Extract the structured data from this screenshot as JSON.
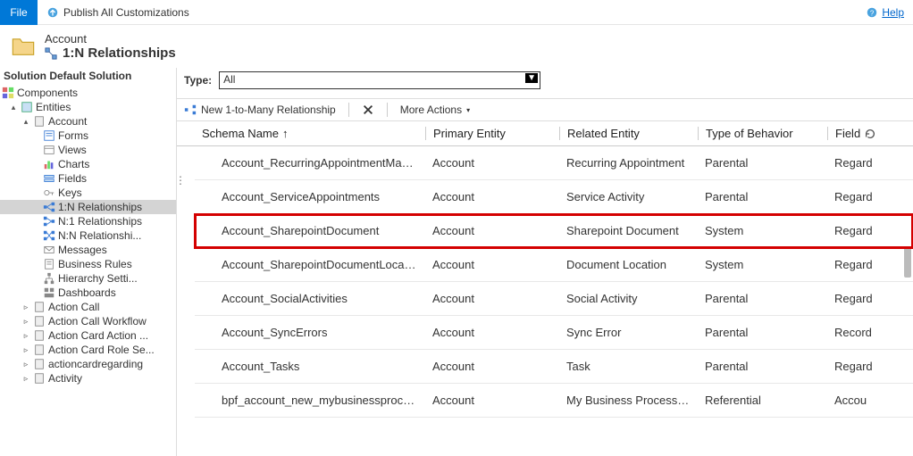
{
  "topbar": {
    "file": "File",
    "publish": "Publish All Customizations",
    "help": "Help"
  },
  "header": {
    "entity": "Account",
    "page": "1:N Relationships"
  },
  "solution_label": "Solution Default Solution",
  "tree": {
    "components": "Components",
    "entities": "Entities",
    "account": "Account",
    "forms": "Forms",
    "views": "Views",
    "charts": "Charts",
    "fields": "Fields",
    "keys": "Keys",
    "rel1n": "1:N Relationships",
    "reln1": "N:1 Relationships",
    "relnn": "N:N Relationshi...",
    "messages": "Messages",
    "busrules": "Business Rules",
    "hierarchy": "Hierarchy Setti...",
    "dashboards": "Dashboards",
    "actioncall": "Action Call",
    "actioncallwf": "Action Call Workflow",
    "actioncardaction": "Action Card Action ...",
    "actioncardrole": "Action Card Role Se...",
    "actioncardreg": "actioncardregarding",
    "activity": "Activity"
  },
  "type_filter": {
    "label": "Type:",
    "value": "All"
  },
  "toolbar": {
    "new": "New 1-to-Many Relationship",
    "more": "More Actions"
  },
  "columns": {
    "schema": "Schema Name",
    "primary": "Primary Entity",
    "related": "Related Entity",
    "behavior": "Type of Behavior",
    "field": "Field"
  },
  "rows": [
    {
      "schema": "Account_RecurringAppointmentMasters",
      "primary": "Account",
      "related": "Recurring Appointment",
      "behavior": "Parental",
      "field": "Regard",
      "highlighted": false
    },
    {
      "schema": "Account_ServiceAppointments",
      "primary": "Account",
      "related": "Service Activity",
      "behavior": "Parental",
      "field": "Regard",
      "highlighted": false
    },
    {
      "schema": "Account_SharepointDocument",
      "primary": "Account",
      "related": "Sharepoint Document",
      "behavior": "System",
      "field": "Regard",
      "highlighted": true
    },
    {
      "schema": "Account_SharepointDocumentLocation",
      "primary": "Account",
      "related": "Document Location",
      "behavior": "System",
      "field": "Regard",
      "highlighted": false
    },
    {
      "schema": "Account_SocialActivities",
      "primary": "Account",
      "related": "Social Activity",
      "behavior": "Parental",
      "field": "Regard",
      "highlighted": false
    },
    {
      "schema": "Account_SyncErrors",
      "primary": "Account",
      "related": "Sync Error",
      "behavior": "Parental",
      "field": "Record",
      "highlighted": false
    },
    {
      "schema": "Account_Tasks",
      "primary": "Account",
      "related": "Task",
      "behavior": "Parental",
      "field": "Regard",
      "highlighted": false
    },
    {
      "schema": "bpf_account_new_mybusinessprocessflow",
      "primary": "Account",
      "related": "My Business Process F...",
      "behavior": "Referential",
      "field": "Accou",
      "highlighted": false
    }
  ]
}
